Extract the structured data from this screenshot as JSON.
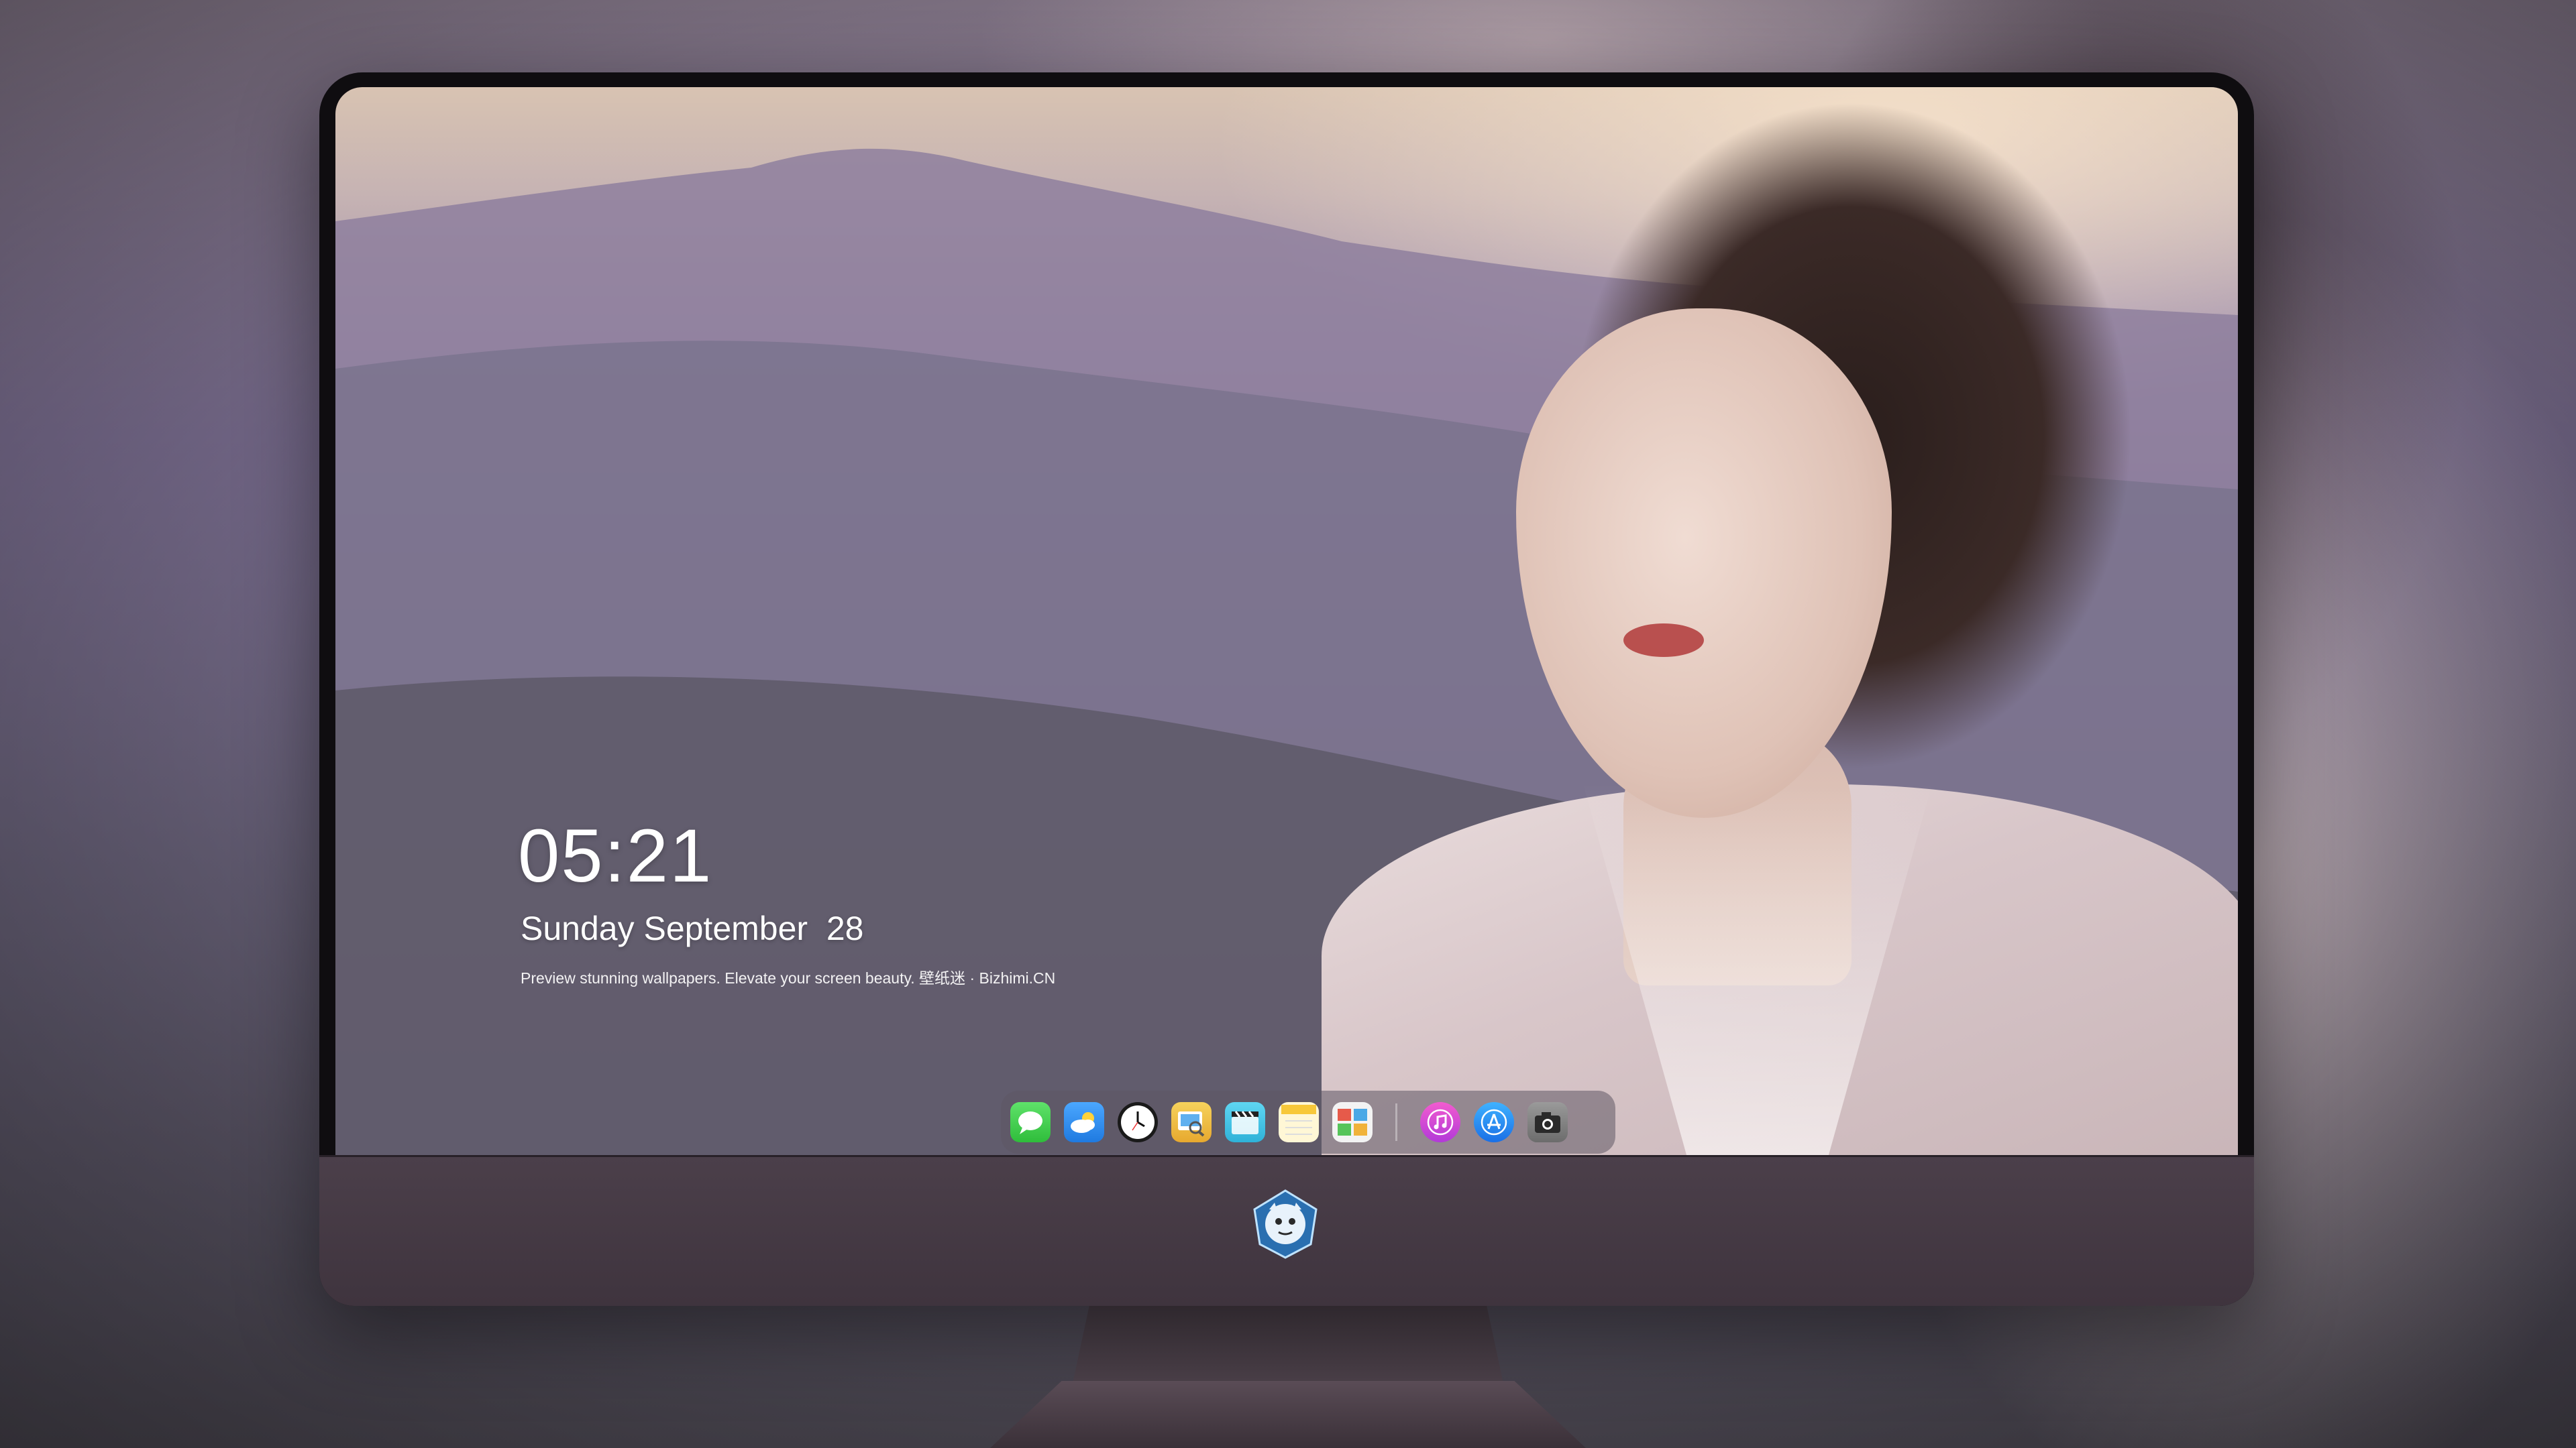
{
  "lockscreen": {
    "time": "05:21",
    "date": "Sunday September  28",
    "caption": "Preview stunning wallpapers. Elevate your screen beauty. 壁纸迷 · Bizhimi.CN"
  },
  "dock": {
    "apps": [
      {
        "name": "messages",
        "icon": "speech-bubble",
        "color": "#3fcf4a"
      },
      {
        "name": "weather",
        "icon": "cloud-sun",
        "color": "#2f8ef0"
      },
      {
        "name": "clock",
        "icon": "clock",
        "color": "#1a1a1a"
      },
      {
        "name": "preview",
        "icon": "photo-magnifier",
        "color": "#f2c84a"
      },
      {
        "name": "video",
        "icon": "clapperboard",
        "color": "#45c7e8"
      },
      {
        "name": "notes",
        "icon": "note-pad",
        "color": "#f7d64a"
      },
      {
        "name": "photo-gallery",
        "icon": "photos",
        "color": "#7fb6d9"
      },
      {
        "name": "music",
        "icon": "music-note",
        "color": "#e44ab7"
      },
      {
        "name": "app-store",
        "icon": "app-store",
        "color": "#1f8ff2"
      },
      {
        "name": "camera",
        "icon": "camera",
        "color": "#8c8c8c"
      }
    ]
  },
  "colors": {
    "bezel": "#0f0d10",
    "chin": "#453945",
    "dock_bg": "rgba(95,88,100,0.55)"
  }
}
